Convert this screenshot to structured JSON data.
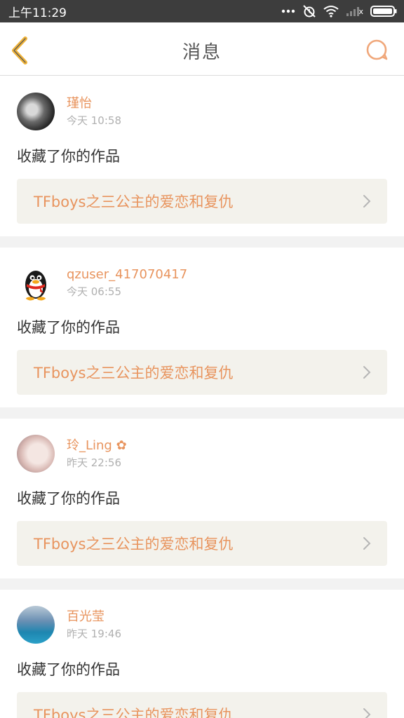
{
  "status_bar": {
    "time": "上午11:29",
    "signal_label": "x"
  },
  "header": {
    "title": "消息"
  },
  "messages": [
    {
      "username": "瑾怡",
      "time": "今天 10:58",
      "action": "收藏了你的作品",
      "work_title": "TFboys之三公主的爱恋和复仇",
      "avatar_icon": "avatar-photo-couple"
    },
    {
      "username": "qzuser_417070417",
      "time": "今天 06:55",
      "action": "收藏了你的作品",
      "work_title": "TFboys之三公主的爱恋和复仇",
      "avatar_icon": "qq-penguin-avatar"
    },
    {
      "username": "玲_Ling ✿",
      "time": "昨天 22:56",
      "action": "收藏了你的作品",
      "work_title": "TFboys之三公主的爱恋和复仇",
      "avatar_icon": "avatar-photo-girl"
    },
    {
      "username": "百光莹",
      "time": "昨天 19:46",
      "action": "收藏了你的作品",
      "work_title": "TFboys之三公主的爱恋和复仇",
      "avatar_icon": "avatar-photo-dress"
    }
  ],
  "colors": {
    "accent": "#e8945e",
    "back_icon": "#f0b338",
    "status_bar_bg": "#3d3d3d",
    "card_link_bg": "#f3f2ec"
  }
}
